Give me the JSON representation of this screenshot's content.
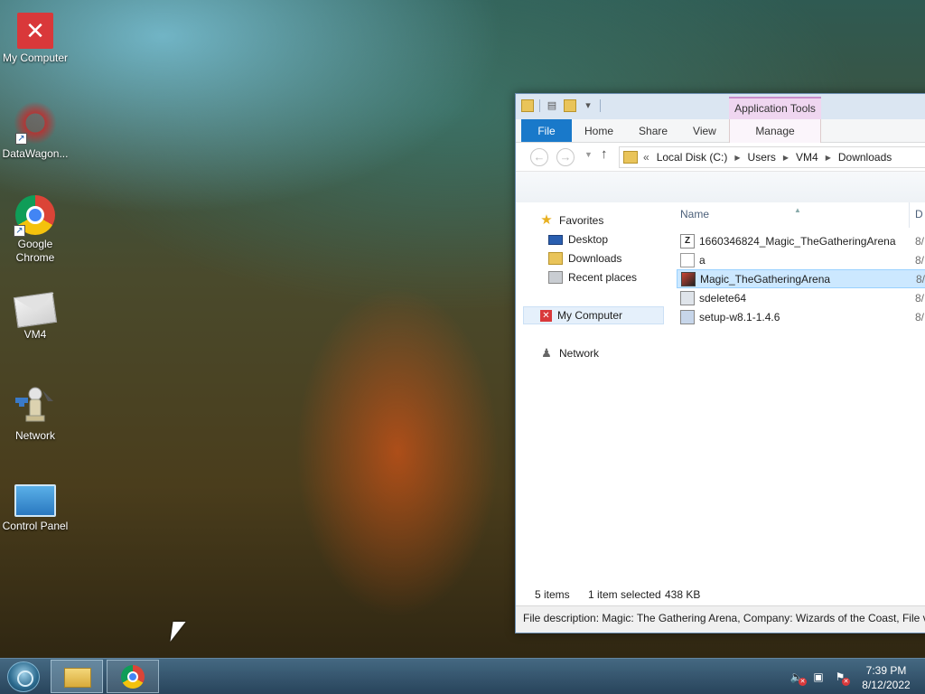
{
  "desktop": {
    "icons": [
      {
        "label": "My Computer",
        "icon": "my-computer-icon"
      },
      {
        "label": "DataWagon...",
        "icon": "datawagon-icon"
      },
      {
        "label": "Google Chrome",
        "icon": "chrome-icon"
      },
      {
        "label": "VM4",
        "icon": "envelope-icon"
      },
      {
        "label": "Network",
        "icon": "network-icon"
      },
      {
        "label": "Control Panel",
        "icon": "control-panel-icon"
      }
    ]
  },
  "explorer": {
    "context_tab_group": "Application Tools",
    "ribbon_tabs": [
      "File",
      "Home",
      "Share",
      "View",
      "Manage"
    ],
    "address": {
      "prefix": "«",
      "crumbs": [
        "Local Disk (C:)",
        "Users",
        "VM4",
        "Downloads"
      ]
    },
    "nav": {
      "favorites": "Favorites",
      "desktop": "Desktop",
      "downloads": "Downloads",
      "recent": "Recent places",
      "my_computer": "My Computer",
      "network": "Network"
    },
    "columns": {
      "name": "Name",
      "date": "D"
    },
    "files": [
      {
        "name": "1660346824_Magic_TheGatheringArena",
        "date": "8/",
        "icon": "zip-icon"
      },
      {
        "name": "a",
        "date": "8/",
        "icon": "blank-file-icon"
      },
      {
        "name": "Magic_TheGatheringArena",
        "date": "8/",
        "icon": "app-icon",
        "selected": true
      },
      {
        "name": "sdelete64",
        "date": "8/",
        "icon": "exe-icon"
      },
      {
        "name": "setup-w8.1-1.4.6",
        "date": "8/",
        "icon": "setup-icon"
      }
    ],
    "status": {
      "count": "5 items",
      "selected": "1 item selected",
      "size": "438 KB"
    },
    "details": "File description: Magic: The Gathering Arena, Company: Wizards of the Coast, File ve"
  },
  "taskbar": {
    "time": "7:39 PM",
    "date": "8/12/2022"
  }
}
